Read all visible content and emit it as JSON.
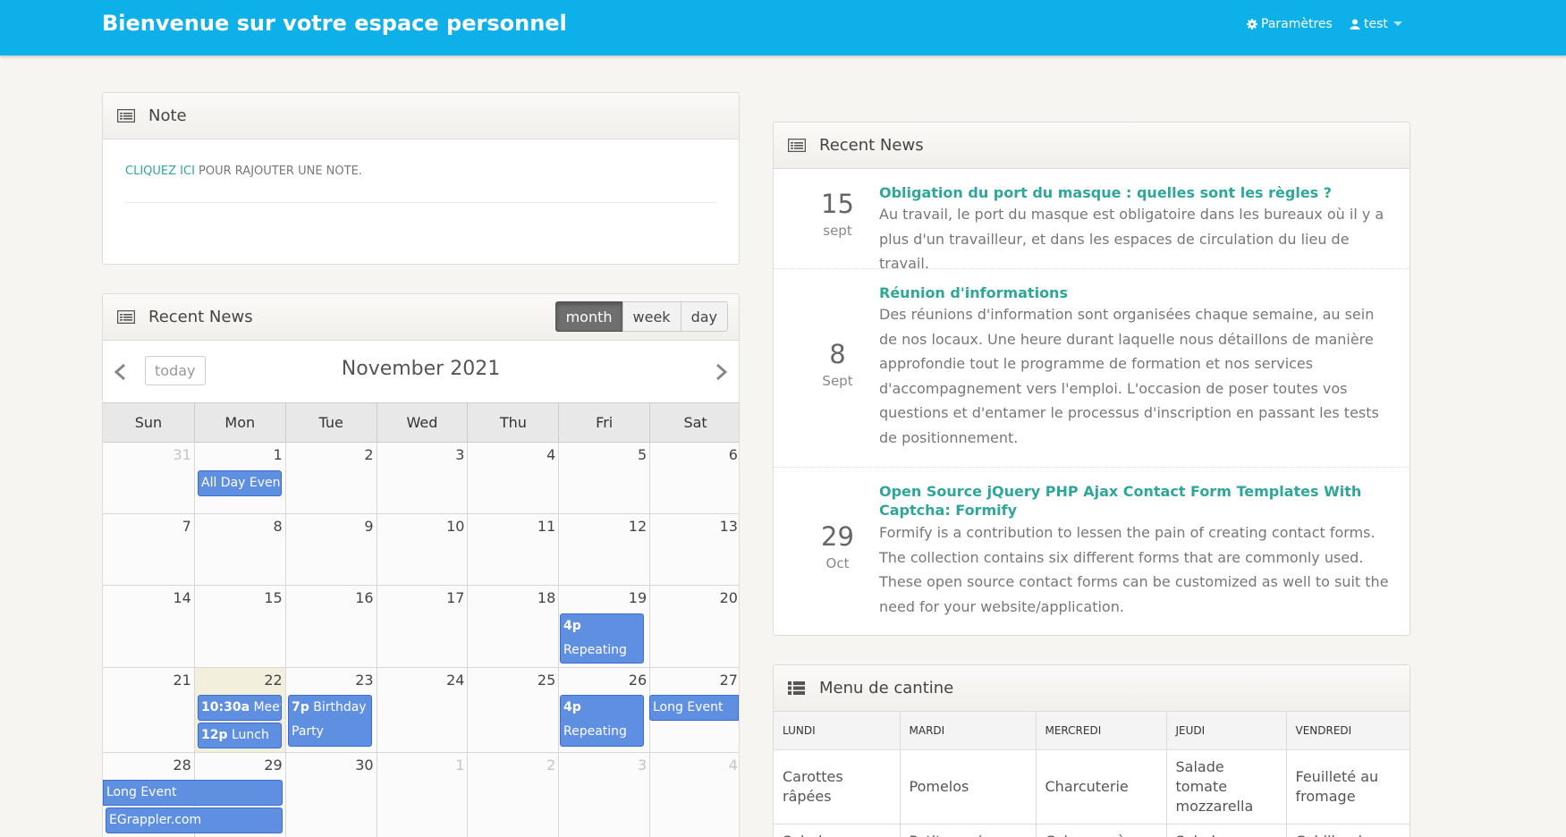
{
  "header": {
    "title": "Bienvenue sur votre espace personnel",
    "settings_label": "Paramètres",
    "user_label": "test",
    "bg_color": "#0eb0ea"
  },
  "note_panel": {
    "title": "Note",
    "link_text": "CLIQUEZ ICI",
    "text": " POUR RAJOUTER UNE NOTE."
  },
  "calendar_panel": {
    "title": "Recent News",
    "views": [
      "month",
      "week",
      "day"
    ],
    "active_view": "month",
    "today_label": "today",
    "month_title": "November 2021",
    "weekdays": [
      "Sun",
      "Mon",
      "Tue",
      "Wed",
      "Thu",
      "Fri",
      "Sat"
    ],
    "weeks": [
      [
        "31",
        "1",
        "2",
        "3",
        "4",
        "5",
        "6"
      ],
      [
        "7",
        "8",
        "9",
        "10",
        "11",
        "12",
        "13"
      ],
      [
        "14",
        "15",
        "16",
        "17",
        "18",
        "19",
        "20"
      ],
      [
        "21",
        "22",
        "23",
        "24",
        "25",
        "26",
        "27"
      ],
      [
        "28",
        "29",
        "30",
        "1",
        "2",
        "3",
        "4"
      ]
    ],
    "events": [
      {
        "time": "",
        "title": "All Day Event",
        "day": "1"
      },
      {
        "time": "4p",
        "title": "Repeating Event",
        "day": "19"
      },
      {
        "time": "10:30a",
        "title": "Meeting",
        "day": "22"
      },
      {
        "time": "12p",
        "title": "Lunch",
        "day": "22"
      },
      {
        "time": "7p",
        "title": "Birthday Party",
        "day": "23"
      },
      {
        "time": "4p",
        "title": "Repeating Event",
        "day": "26"
      },
      {
        "time": "",
        "title": "Long Event",
        "day": "27"
      },
      {
        "time": "",
        "title": "Long Event",
        "day": "28"
      },
      {
        "time": "",
        "title": "EGrappler.com",
        "day": "28"
      }
    ],
    "event_color": "#5f8fe0"
  },
  "news_panel": {
    "title": "Recent News",
    "items": [
      {
        "day": "15",
        "month": "sept",
        "title": "Obligation du port du masque : quelles sont les règles ?",
        "body": "Au travail, le port du masque est obligatoire dans les bureaux où il y a plus d'un travailleur, et dans les espaces de circulation du lieu de travail."
      },
      {
        "day": "8",
        "month": "Sept",
        "title": "Réunion d'informations",
        "body": "Des réunions d'information sont organisées chaque semaine, au sein de nos locaux. Une heure durant laquelle nous détaillons de manière approfondie tout le programme de formation et nos services d'accompagnement vers l'emploi. L'occasion de poser toutes vos questions et d'entamer le processus d'inscription en passant les tests de positionnement."
      },
      {
        "day": "29",
        "month": "Oct",
        "title": "Open Source jQuery PHP Ajax Contact Form Templates With Captcha: Formify",
        "body": "Formify is a contribution to lessen the pain of creating contact forms. The collection contains six different forms that are commonly used. These open source contact forms can be customized as well to suit the need for your website/application."
      }
    ]
  },
  "cantine_panel": {
    "title": "Menu de cantine",
    "columns": [
      "LUNDI",
      "MARDI",
      "MERCREDI",
      "JEUDI",
      "VENDREDI"
    ],
    "rows": [
      [
        "Carottes râpées",
        "Pomelos",
        "Charcuterie",
        "Salade tomate mozzarella",
        "Feuilleté au fromage"
      ],
      [
        "Salade aux",
        "Petites saisons",
        "Calamars à",
        "Salade",
        "Cabillaud"
      ]
    ]
  },
  "accent_color": "#2ea79a"
}
